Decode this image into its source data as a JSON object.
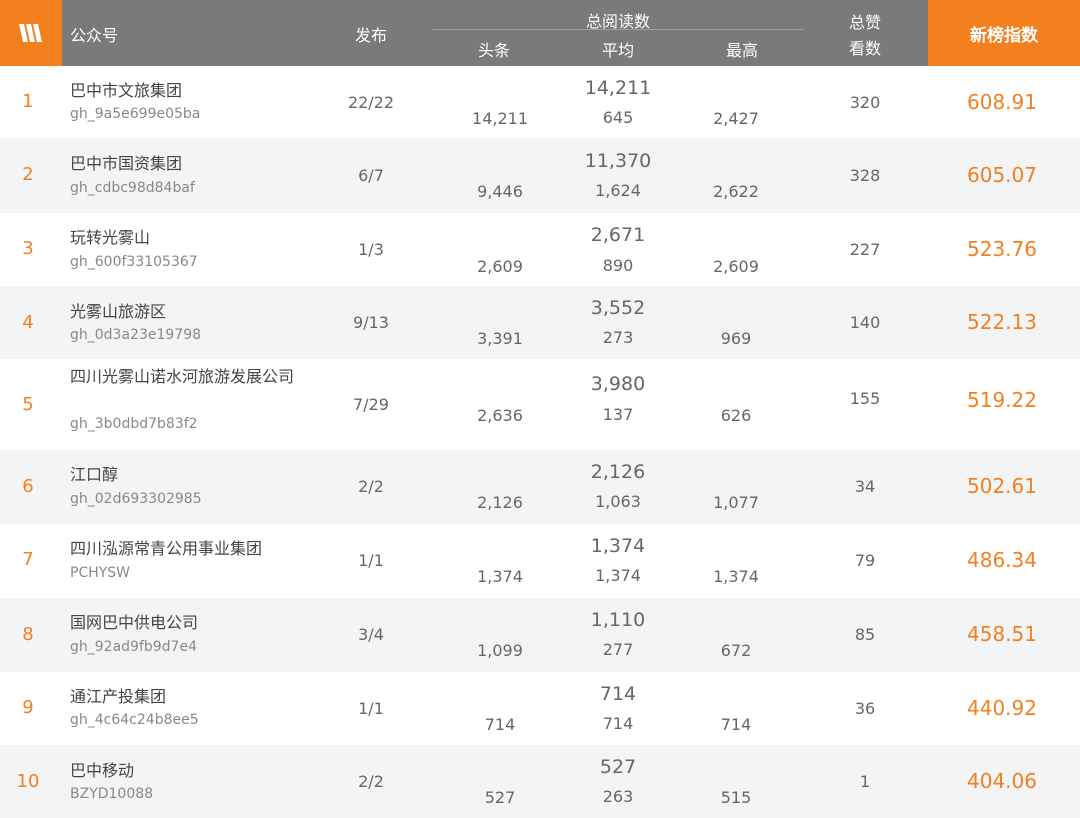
{
  "header": {
    "account_label": "公众号",
    "publish_label": "发布",
    "total_reads_label": "总阅读数",
    "headline_label": "头条",
    "average_label": "平均",
    "max_label": "最高",
    "likes_label_line1": "总赞",
    "likes_label_line2": "看数",
    "index_label": "新榜指数"
  },
  "colors": {
    "accent": "#f47f1e",
    "header_bg": "#7a7a7a",
    "alt_row": "#f3f4f6"
  },
  "rows": [
    {
      "rank": "1",
      "name": "巴中市文旅集团",
      "account": "gh_9a5e699e05ba",
      "publish": "22/22",
      "total": "14,211",
      "headline": "14,211",
      "average": "645",
      "max": "2,427",
      "likes": "320",
      "score": "608.91"
    },
    {
      "rank": "2",
      "name": "巴中市国资集团",
      "account": "gh_cdbc98d84baf",
      "publish": "6/7",
      "total": "11,370",
      "headline": "9,446",
      "average": "1,624",
      "max": "2,622",
      "likes": "328",
      "score": "605.07"
    },
    {
      "rank": "3",
      "name": "玩转光雾山",
      "account": "gh_600f33105367",
      "publish": "1/3",
      "total": "2,671",
      "headline": "2,609",
      "average": "890",
      "max": "2,609",
      "likes": "227",
      "score": "523.76"
    },
    {
      "rank": "4",
      "name": "光雾山旅游区",
      "account": "gh_0d3a23e19798",
      "publish": "9/13",
      "total": "3,552",
      "headline": "3,391",
      "average": "273",
      "max": "969",
      "likes": "140",
      "score": "522.13"
    },
    {
      "rank": "5",
      "name": "四川光雾山诺水河旅游发展公司",
      "account": "gh_3b0dbd7b83f2",
      "publish": "7/29",
      "total": "3,980",
      "headline": "2,636",
      "average": "137",
      "max": "626",
      "likes": "155",
      "score": "519.22"
    },
    {
      "rank": "6",
      "name": "江口醇",
      "account": "gh_02d693302985",
      "publish": "2/2",
      "total": "2,126",
      "headline": "2,126",
      "average": "1,063",
      "max": "1,077",
      "likes": "34",
      "score": "502.61"
    },
    {
      "rank": "7",
      "name": "四川泓源常青公用事业集团",
      "account": "PCHYSW",
      "publish": "1/1",
      "total": "1,374",
      "headline": "1,374",
      "average": "1,374",
      "max": "1,374",
      "likes": "79",
      "score": "486.34"
    },
    {
      "rank": "8",
      "name": "国网巴中供电公司",
      "account": "gh_92ad9fb9d7e4",
      "publish": "3/4",
      "total": "1,110",
      "headline": "1,099",
      "average": "277",
      "max": "672",
      "likes": "85",
      "score": "458.51"
    },
    {
      "rank": "9",
      "name": "通江产投集团",
      "account": "gh_4c64c24b8ee5",
      "publish": "1/1",
      "total": "714",
      "headline": "714",
      "average": "714",
      "max": "714",
      "likes": "36",
      "score": "440.92"
    },
    {
      "rank": "10",
      "name": "巴中移动",
      "account": "BZYD10088",
      "publish": "2/2",
      "total": "527",
      "headline": "527",
      "average": "263",
      "max": "515",
      "likes": "1",
      "score": "404.06"
    }
  ]
}
